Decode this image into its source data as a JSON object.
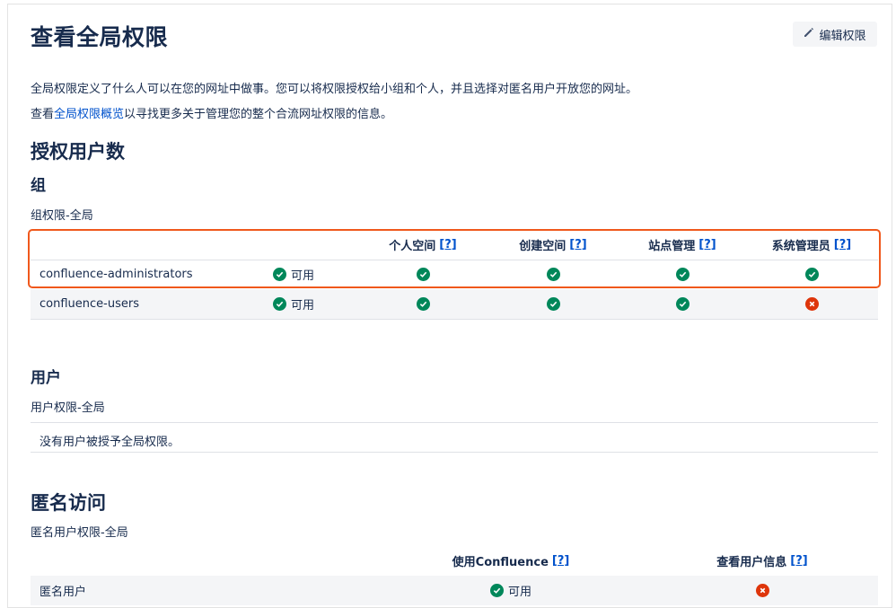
{
  "page": {
    "title": "查看全局权限",
    "edit_button_label": "编辑权限",
    "intro": "全局权限定义了什么人可以在您的网址中做事。您可以将权限授权给小组和个人，并且选择对匿名用户开放您的网址。",
    "overview_prefix": "查看",
    "overview_link": "全局权限概览",
    "overview_suffix": "以寻找更多关于管理您的整个合流网址权限的信息。"
  },
  "licensed": {
    "heading": "授权用户数",
    "groups_heading": "组",
    "groups_caption": "组权限-全局",
    "columns": [
      {
        "label": "个人空间",
        "help": "[?]"
      },
      {
        "label": "创建空间",
        "help": "[?]"
      },
      {
        "label": "站点管理",
        "help": "[?]"
      },
      {
        "label": "系统管理员",
        "help": "[?]"
      }
    ],
    "groups": [
      {
        "name": "confluence-administrators",
        "status": "可用",
        "perms": [
          true,
          true,
          true,
          true
        ],
        "highlighted": true
      },
      {
        "name": "confluence-users",
        "status": "可用",
        "perms": [
          true,
          true,
          true,
          false
        ],
        "highlighted": false
      }
    ],
    "users_heading": "用户",
    "users_caption": "用户权限-全局",
    "users_empty": "没有用户被授予全局权限。"
  },
  "anonymous": {
    "heading": "匿名访问",
    "caption": "匿名用户权限-全局",
    "columns": [
      {
        "label": "使用Confluence",
        "help": "[?]"
      },
      {
        "label": "查看用户信息",
        "help": "[?]"
      }
    ],
    "rows": [
      {
        "name": "匿名用户",
        "use_status": "可用",
        "use": true,
        "view_profiles": false
      }
    ]
  },
  "colors": {
    "ok": "#00875a",
    "no": "#de350b",
    "link": "#0052cc",
    "highlight": "#f0581c"
  },
  "icons": {
    "edit": "pencil-icon",
    "ok": "check-circle-icon",
    "no": "cross-circle-icon"
  }
}
